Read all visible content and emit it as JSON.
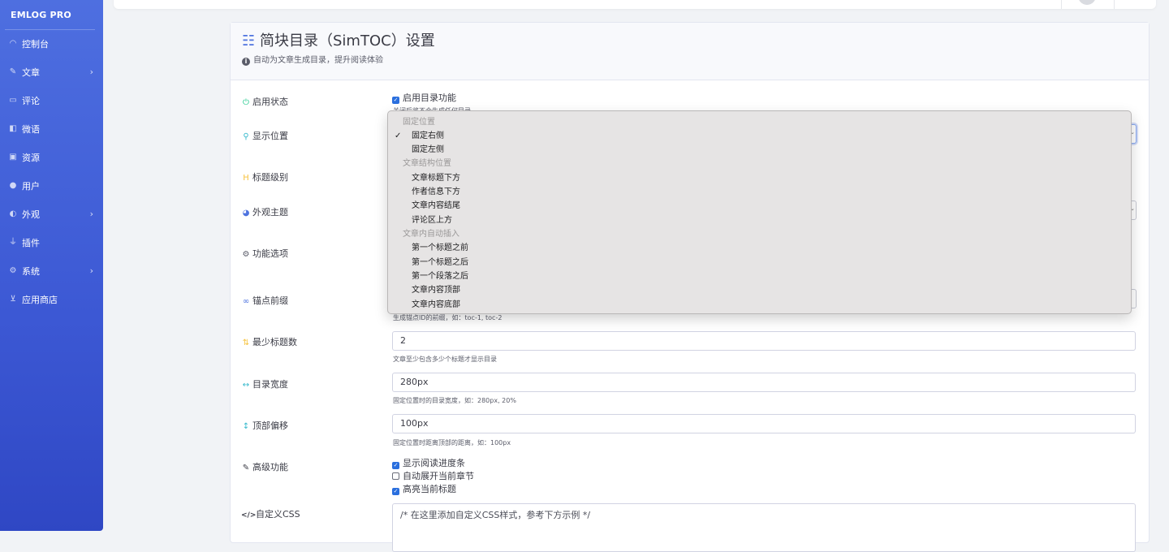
{
  "sidebar": {
    "brand": "EMLOG PRO",
    "items": [
      {
        "label": "控制台",
        "icon": "dashboard-icon",
        "glyph": "◠",
        "has_children": false
      },
      {
        "label": "文章",
        "icon": "pencil-icon",
        "glyph": "✎",
        "has_children": true
      },
      {
        "label": "评论",
        "icon": "comment-icon",
        "glyph": "▭",
        "has_children": false
      },
      {
        "label": "微语",
        "icon": "note-icon",
        "glyph": "◧",
        "has_children": false
      },
      {
        "label": "资源",
        "icon": "image-icon",
        "glyph": "▣",
        "has_children": false
      },
      {
        "label": "用户",
        "icon": "user-icon",
        "glyph": "●",
        "has_children": false
      },
      {
        "label": "外观",
        "icon": "palette-icon",
        "glyph": "◐",
        "has_children": true
      },
      {
        "label": "插件",
        "icon": "plug-icon",
        "glyph": "⏚",
        "has_children": false
      },
      {
        "label": "系统",
        "icon": "gear-icon",
        "glyph": "⚙",
        "has_children": true
      },
      {
        "label": "应用商店",
        "icon": "cart-icon",
        "glyph": "⊻",
        "has_children": false
      }
    ],
    "chevron": "›"
  },
  "header": {
    "title": "简块目录（SimTOC）设置",
    "title_icon": "list-icon",
    "title_glyph": "☷",
    "subtitle": "自动为文章生成目录，提升阅读体验",
    "subtitle_icon": "info-icon"
  },
  "form": {
    "enable": {
      "label": "启用状态",
      "icon": "power-icon",
      "glyph": "⏻",
      "checkbox_label": "启用目录功能",
      "checked": true,
      "help": "关闭后将不会生成任何目录"
    },
    "position": {
      "label": "显示位置",
      "icon": "map-marker-icon",
      "glyph": "⚲"
    },
    "heading_level": {
      "label": "标题级别",
      "icon": "heading-icon",
      "glyph": "H"
    },
    "theme": {
      "label": "外观主题",
      "icon": "palette-icon",
      "glyph": "◕"
    },
    "features": {
      "label": "功能选项",
      "icon": "cogs-icon",
      "glyph": "⚙"
    },
    "anchor_prefix": {
      "label": "锚点前缀",
      "icon": "link-icon",
      "glyph": "∞",
      "help": "生成锚点ID的前缀，如：toc-1, toc-2"
    },
    "min_headings": {
      "label": "最少标题数",
      "icon": "sort-icon",
      "glyph": "⇅",
      "value": "2",
      "help": "文章至少包含多少个标题才显示目录"
    },
    "width": {
      "label": "目录宽度",
      "icon": "arrows-h-icon",
      "glyph": "↔",
      "value": "280px",
      "help": "固定位置时的目录宽度，如：280px, 20%"
    },
    "top_offset": {
      "label": "顶部偏移",
      "icon": "arrows-v-icon",
      "glyph": "↕",
      "value": "100px",
      "help": "固定位置时距离顶部的距离，如：100px"
    },
    "advanced": {
      "label": "高级功能",
      "icon": "pen-icon",
      "glyph": "✎",
      "options": [
        {
          "label": "显示阅读进度条",
          "checked": true
        },
        {
          "label": "自动展开当前章节",
          "checked": false
        },
        {
          "label": "高亮当前标题",
          "checked": true
        }
      ]
    },
    "custom_css": {
      "label": "自定义CSS",
      "icon": "code-icon",
      "glyph": "</>",
      "placeholder": "/* 在这里添加自定义CSS样式，参考下方示例 */"
    }
  },
  "position_dropdown": {
    "groups": [
      {
        "label": "固定位置",
        "options": [
          {
            "label": "固定右侧",
            "selected": true
          },
          {
            "label": "固定左侧",
            "selected": false
          }
        ]
      },
      {
        "label": "文章结构位置",
        "options": [
          {
            "label": "文章标题下方",
            "selected": false
          },
          {
            "label": "作者信息下方",
            "selected": false
          },
          {
            "label": "文章内容结尾",
            "selected": false
          },
          {
            "label": "评论区上方",
            "selected": false
          }
        ]
      },
      {
        "label": "文章内自动插入",
        "options": [
          {
            "label": "第一个标题之前",
            "selected": false
          },
          {
            "label": "第一个标题之后",
            "selected": false
          },
          {
            "label": "第一个段落之后",
            "selected": false
          },
          {
            "label": "文章内容顶部",
            "selected": false
          },
          {
            "label": "文章内容底部",
            "selected": false
          }
        ]
      }
    ],
    "check_glyph": "✓"
  },
  "colors": {
    "sidebar": "#3c58d4",
    "accent": "#4e73df",
    "checkbox": "#2a6fde"
  }
}
